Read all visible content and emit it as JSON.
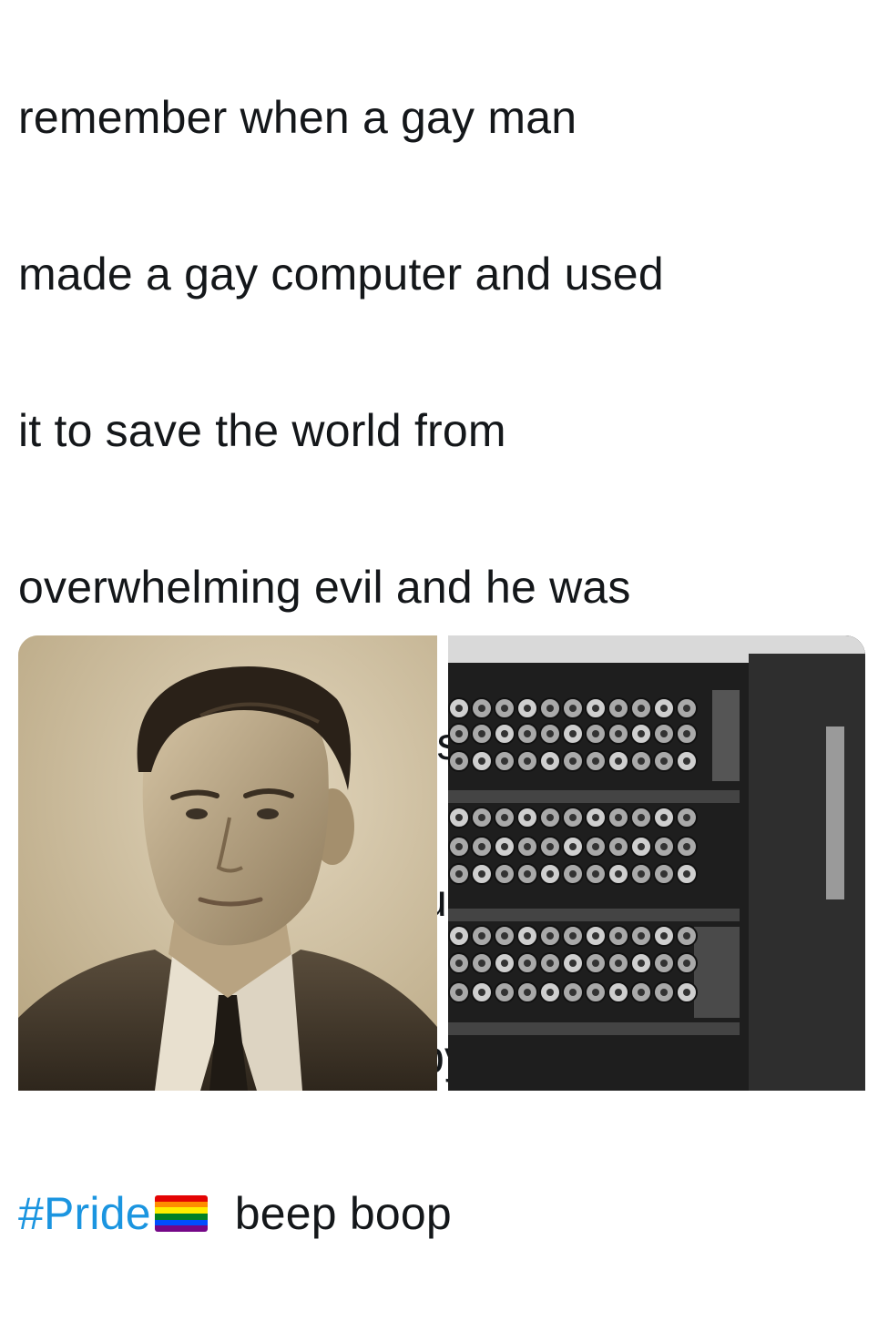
{
  "post": {
    "text_lines": [
      "remember when a gay man",
      "made a gay computer and used",
      "it to save the world from",
      "overwhelming evil and he was",
      "rewarded with checks notes",
      "chemical torture resulting in his",
      "suicide anyway happy"
    ],
    "hashtag": "#Pride",
    "after_hashtag": "beep boop",
    "flag_icon": "rainbow-flag-icon",
    "flag_colors": [
      "#e40303",
      "#ff8c00",
      "#ffed00",
      "#008026",
      "#004dff",
      "#750787"
    ],
    "hashtag_color": "#1b95e0"
  },
  "media": {
    "left_photo_icon": "man-portrait-photo",
    "right_photo_icon": "bombe-machine-photo"
  }
}
